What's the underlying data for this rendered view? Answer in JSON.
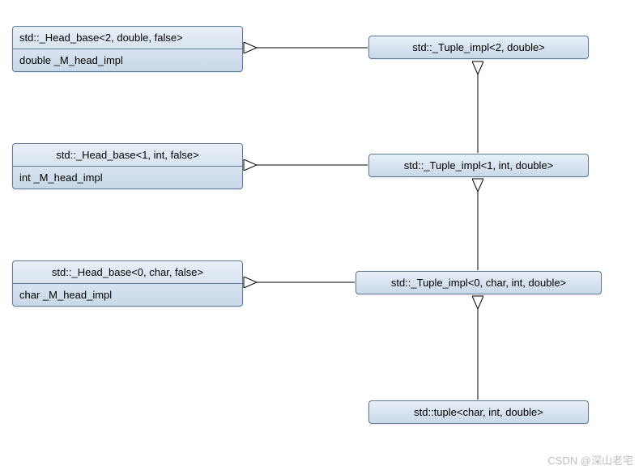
{
  "boxes": {
    "head2": {
      "title": "std::_Head_base<2, double, false>",
      "attr": "double _M_head_impl"
    },
    "head1": {
      "title": "std::_Head_base<1, int, false>",
      "attr": "int _M_head_impl"
    },
    "head0": {
      "title": "std::_Head_base<0, char, false>",
      "attr": "char _M_head_impl"
    },
    "tup2": {
      "title": "std::_Tuple_impl<2, double>"
    },
    "tup1": {
      "title": "std::_Tuple_impl<1, int, double>"
    },
    "tup0": {
      "title": "std::_Tuple_impl<0, char, int, double>"
    },
    "tuple": {
      "title": "std::tuple<char, int, double>"
    }
  },
  "watermark": "CSDN @深山老宅"
}
